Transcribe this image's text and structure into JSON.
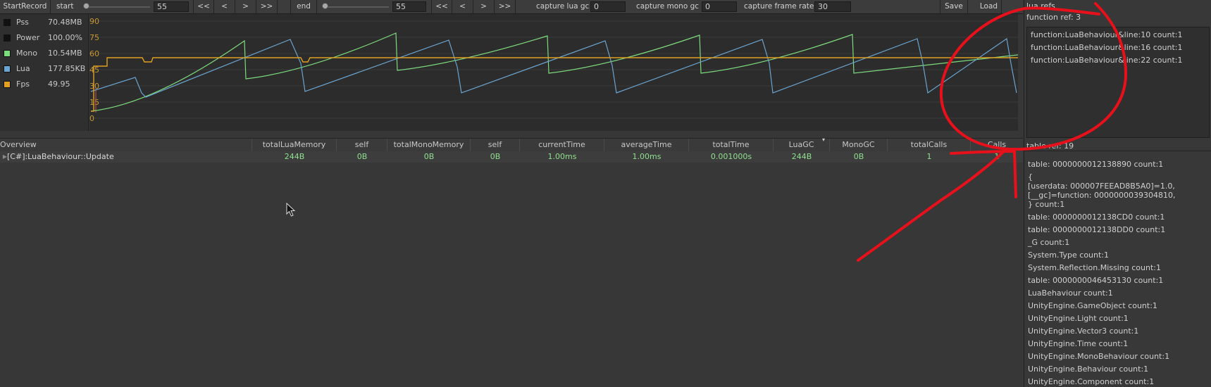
{
  "toolbar": {
    "start_record": "StartRecord",
    "start_label": "start",
    "start_value": "55",
    "nav_first": "<<",
    "nav_prev": "<",
    "nav_next": ">",
    "nav_last": ">>",
    "end_label": "end",
    "end_value": "55",
    "capture_lua_gc_label": "capture lua gc",
    "capture_lua_gc_value": "0",
    "capture_mono_gc_label": "capture mono gc",
    "capture_mono_gc_value": "0",
    "capture_frame_rate_label": "capture frame rate",
    "capture_frame_rate_value": "30",
    "save": "Save",
    "load": "Load"
  },
  "legend": [
    {
      "name": "Pss",
      "value": "70.48MB",
      "color": "#111111"
    },
    {
      "name": "Power",
      "value": "100.00%",
      "color": "#111111"
    },
    {
      "name": "Mono",
      "value": "10.54MB",
      "color": "#7ddc7d"
    },
    {
      "name": "Lua",
      "value": "177.85KB",
      "color": "#6aa4d0"
    },
    {
      "name": "Fps",
      "value": "49.95",
      "color": "#e0a020"
    }
  ],
  "chart_data": {
    "type": "line",
    "y_ticks": [
      "90",
      "75",
      "60",
      "45",
      "30",
      "15",
      "0"
    ],
    "ylim": [
      0,
      90
    ],
    "series": [
      {
        "name": "Mono",
        "color": "#7ddc7d"
      },
      {
        "name": "Lua",
        "color": "#6aa4d0"
      },
      {
        "name": "Fps",
        "color": "#e0a020"
      }
    ],
    "colors": {
      "mono": "#7ddc7d",
      "lua": "#6aa4d0",
      "fps": "#e0a020",
      "marker": "#d05050"
    }
  },
  "table": {
    "columns": [
      "Overview",
      "totalLuaMemory",
      "self",
      "totalMonoMemory",
      "self",
      "currentTime",
      "averageTime",
      "totalTime",
      "LuaGC",
      "MonoGC",
      "totalCalls",
      "Calls"
    ],
    "rows": [
      {
        "name": "[C#]:LuaBehaviour::Update",
        "totalLuaMemory": "244B",
        "self1": "0B",
        "totalMonoMemory": "0B",
        "self2": "0B",
        "currentTime": "1.00ms",
        "averageTime": "1.00ms",
        "totalTime": "0.001000s",
        "LuaGC": "244B",
        "MonoGC": "0B",
        "totalCalls": "1",
        "Calls": "1"
      }
    ]
  },
  "right_panel": {
    "title": "lua refs",
    "function_ref_title": "function ref: 3",
    "functions": [
      "function:LuaBehaviour&line:10 count:1",
      "function:LuaBehaviour&line:16 count:1",
      "function:LuaBehaviour&line:22 count:1"
    ],
    "table_ref_title": "table ref: 19",
    "tables": [
      "table: 0000000012138890 count:1",
      "{\n[userdata: 000007FEEAD8B5A0]=1.0,\n[__gc]=function: 0000000039304810,\n} count:1",
      "table: 0000000012138CD0 count:1",
      "table: 0000000012138DD0 count:1",
      "_G count:1",
      "System.Type count:1",
      "System.Reflection.Missing count:1",
      "table: 0000000046453130 count:1",
      "LuaBehaviour count:1",
      "UnityEngine.GameObject count:1",
      "UnityEngine.Light count:1",
      "UnityEngine.Vector3 count:1",
      "UnityEngine.Time count:1",
      "UnityEngine.MonoBehaviour count:1",
      "UnityEngine.Behaviour count:1",
      "UnityEngine.Component count:1"
    ]
  },
  "annotation_color": "#e8101a"
}
